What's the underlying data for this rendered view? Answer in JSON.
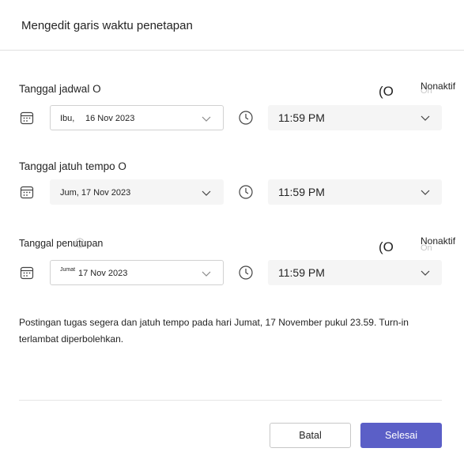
{
  "dialog": {
    "title": "Mengedit garis waktu penetapan"
  },
  "schedule": {
    "label": "Tanggal jadwal O",
    "toggle_glyph": "(O",
    "toggle_text": "Nonaktif",
    "toggle_ghost": "On",
    "date_prefix": "Ibu,",
    "date_value": "16 Nov 2023",
    "time_value": "11:59 PM"
  },
  "due": {
    "label": "Tanggal jatuh tempo O",
    "date_value": "Jum, 17 Nov 2023",
    "time_value": "11:59 PM"
  },
  "close": {
    "label": "Tanggal penutupan",
    "info_glyph": "ⓘ",
    "toggle_glyph": "(O",
    "toggle_text": "Nonaktif",
    "toggle_ghost": "On",
    "date_prefix": "Jumat",
    "date_value": "17 Nov 2023",
    "time_value": "11:59 PM"
  },
  "description": "Postingan tugas segera dan jatuh tempo pada hari Jumat, 17 November pukul 23.59. Turn-in terlambat diperbolehkan.",
  "buttons": {
    "cancel": "Batal",
    "done": "Selesai"
  },
  "colors": {
    "primary": "#5b5fc7",
    "field_fill": "#f5f5f5",
    "border": "#d1d1d1"
  }
}
